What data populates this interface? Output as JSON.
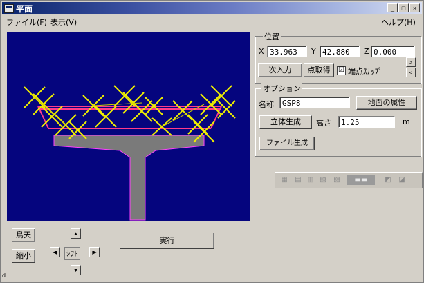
{
  "window": {
    "title": "平面"
  },
  "titlebar": {
    "min": "_",
    "max": "□",
    "close": "×"
  },
  "menu": {
    "file": "ファイル(F)",
    "view": "表示(V)",
    "help": "ヘルプ(H)"
  },
  "position": {
    "group_label": "位置",
    "x_label": "X",
    "x_value": "33.963",
    "y_label": "Y",
    "y_value": "42.880",
    "z_label": "Z",
    "z_value": "0.000",
    "next_input": "次入力",
    "point_take": "点取得",
    "snap_label": "端点ｽﾅｯﾌﾟ",
    "snap_checked": "☑"
  },
  "options": {
    "group_label": "オプション",
    "name_label": "名称",
    "name_value": "GSP8",
    "attr_button": "地面の属性",
    "solid_button": "立体生成",
    "height_label": "高さ",
    "height_value": "1.25",
    "height_unit": "m",
    "file_button": "ファイル生成"
  },
  "view_controls": {
    "overview_button": "鳥天",
    "zoom_out_button": "縮小",
    "shift_label": "ｼﾌﾄ",
    "run_button": "実行",
    "up": "▲",
    "down": "▼",
    "left": "◀",
    "right": "▶"
  },
  "toolbar2": {
    "icons": [
      "tool-icon-1",
      "tool-icon-2",
      "tool-icon-3",
      "tool-icon-4",
      "tool-icon-5",
      "tool-icon-6",
      "tool-icon-7",
      "tool-icon-8"
    ]
  },
  "statusbar": {
    "corner": "d"
  },
  "colors": {
    "canvas_bg": "#05057e",
    "pier": "#7a7a7a",
    "pier_outline": "#ff40ff",
    "markers": "#f0f000",
    "magenta_line": "#ff3a8a"
  }
}
